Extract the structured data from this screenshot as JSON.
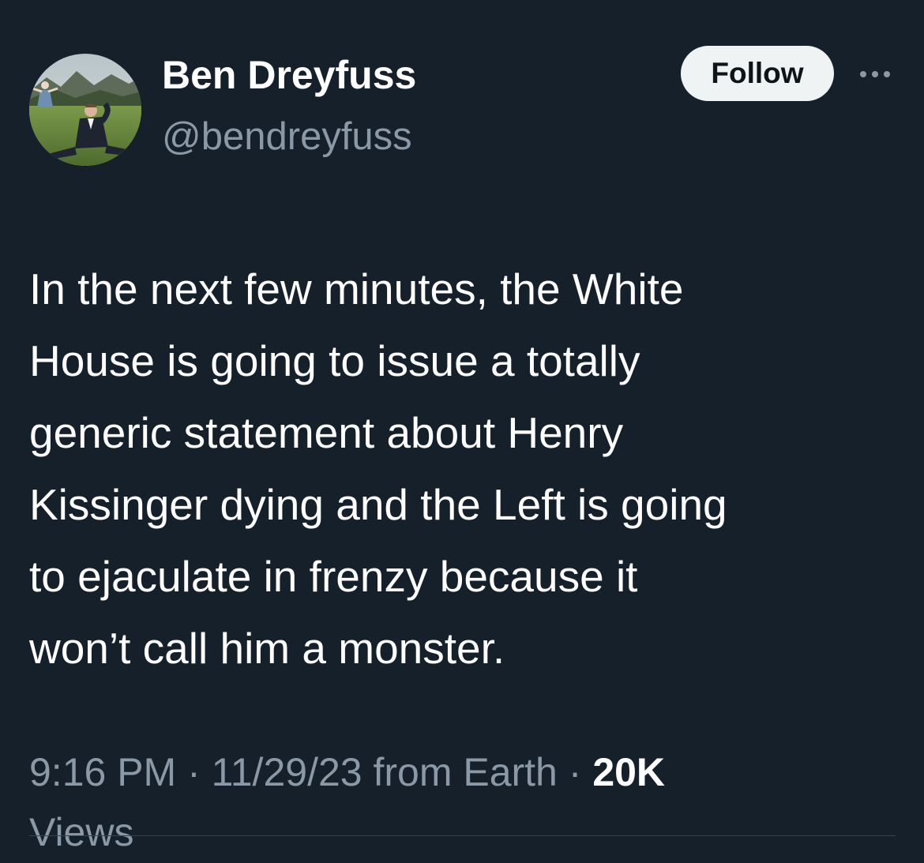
{
  "author": {
    "display_name": "Ben Dreyfuss",
    "handle": "@bendreyfuss",
    "avatar_icon": "profile-photo-meadow-avatar"
  },
  "actions": {
    "follow_label": "Follow",
    "more_icon": "more-options-icon"
  },
  "tweet": {
    "lines": [
      "In the next few minutes, the White",
      "House is going to issue a totally",
      "generic statement about Henry",
      "Kissinger dying and the Left is going",
      "to ejaculate in frenzy because it",
      "won’t call him a monster."
    ]
  },
  "meta": {
    "time": "9:16 PM",
    "separator": " · ",
    "date": "11/29/23",
    "source": " from Earth",
    "views_count": "20K",
    "views_label": "Views"
  },
  "colors": {
    "background": "#15202b",
    "primary_text": "#ffffff",
    "secondary_text": "#8b98a5",
    "follow_button_bg": "#eff3f4",
    "follow_button_text": "#0f1419",
    "divider": "#38444d"
  }
}
